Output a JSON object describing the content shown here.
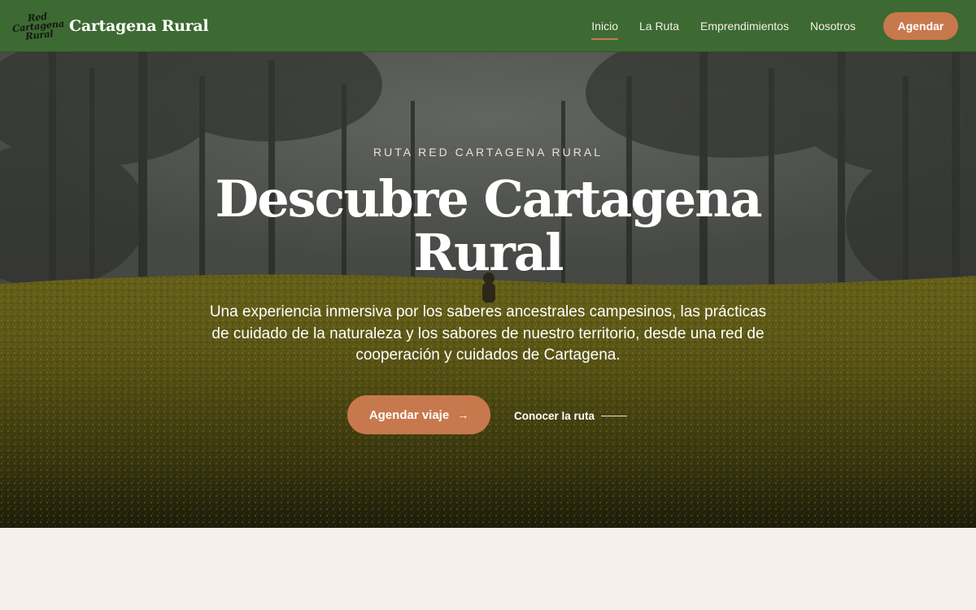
{
  "brand": {
    "logo_lines": [
      "Red",
      "Cartagena",
      "Rural"
    ],
    "name": "Cartagena Rural"
  },
  "nav": {
    "items": [
      {
        "label": "Inicio",
        "active": true
      },
      {
        "label": "La Ruta",
        "active": false
      },
      {
        "label": "Emprendimientos",
        "active": false
      },
      {
        "label": "Nosotros",
        "active": false
      }
    ],
    "cta_label": "Agendar"
  },
  "hero": {
    "eyebrow": "RUTA RED CARTAGENA RURAL",
    "title_line1": "Descubre Cartagena",
    "title_line2": "Rural",
    "lead": "Una experiencia inmersiva por los saberes ancestrales campesinos, las prácticas de cuidado de la naturaleza y los sabores de nuestro territorio, desde una red de cooperación y cuidados de Cartagena.",
    "primary_label": "Agendar viaje",
    "primary_arrow": "→",
    "secondary_label": "Conocer la ruta"
  },
  "colors": {
    "nav_bg": "#3d6a32",
    "accent": "#c8784d",
    "page_bg": "#f5f0e9"
  }
}
